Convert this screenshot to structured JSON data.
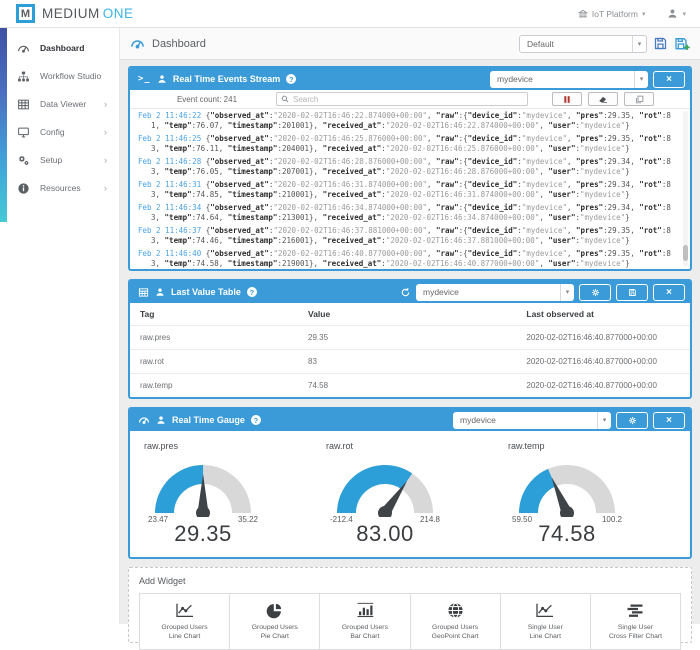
{
  "header": {
    "logo_letter": "M",
    "brand_primary": "MEDIUM",
    "brand_secondary": "ONE",
    "platform_menu": "IoT Platform"
  },
  "glyphs": {
    "caret_down": "▾",
    "chevron_right": "›",
    "close": "×",
    "terminal_prompt": ">_"
  },
  "sidebar": {
    "items": [
      {
        "label": "Dashboard",
        "icon": "gauge-icon",
        "active": true,
        "has_chevron": false
      },
      {
        "label": "Workflow Studio",
        "icon": "sitemap-icon",
        "active": false,
        "has_chevron": false
      },
      {
        "label": "Data Viewer",
        "icon": "table-icon",
        "active": false,
        "has_chevron": true
      },
      {
        "label": "Config",
        "icon": "desktop-icon",
        "active": false,
        "has_chevron": true
      },
      {
        "label": "Setup",
        "icon": "gears-icon",
        "active": false,
        "has_chevron": true
      },
      {
        "label": "Resources",
        "icon": "info-icon",
        "active": false,
        "has_chevron": true
      }
    ]
  },
  "topbar": {
    "title": "Dashboard",
    "dashboard_select_value": "Default"
  },
  "events_stream": {
    "title": "Real Time Events Stream",
    "device_select_value": "mydevice",
    "event_count_label": "Event count: 241",
    "search_placeholder": "Search",
    "entries": [
      {
        "time": "Feb 2 11:46:22",
        "json": "{\"observed_at\":\"2020-02-02T16:46:22.874000+00:00\", \"raw\":{\"device_id\":\"mydevice\", \"pres\":29.35, \"rot\":81, \"temp\":76.07, \"timestamp\":201001}, \"received_at\":\"2020-02-02T16:46:22.874000+00:00\", \"user\":\"mydevice\"}"
      },
      {
        "time": "Feb 2 11:46:25",
        "json": "{\"observed_at\":\"2020-02-02T16:46:25.876000+00:00\", \"raw\":{\"device_id\":\"mydevice\", \"pres\":29.35, \"rot\":83, \"temp\":76.11, \"timestamp\":204001}, \"received_at\":\"2020-02-02T16:46:25.876000+00:00\", \"user\":\"mydevice\"}"
      },
      {
        "time": "Feb 2 11:46:28",
        "json": "{\"observed_at\":\"2020-02-02T16:46:28.876000+00:00\", \"raw\":{\"device_id\":\"mydevice\", \"pres\":29.34, \"rot\":83, \"temp\":76.05, \"timestamp\":207001}, \"received_at\":\"2020-02-02T16:46:28.876000+00:00\", \"user\":\"mydevice\"}"
      },
      {
        "time": "Feb 2 11:46:31",
        "json": "{\"observed_at\":\"2020-02-02T16:46:31.874000+00:00\", \"raw\":{\"device_id\":\"mydevice\", \"pres\":29.34, \"rot\":83, \"temp\":74.85, \"timestamp\":210001}, \"received_at\":\"2020-02-02T16:46:31.874000+00:00\", \"user\":\"mydevice\"}"
      },
      {
        "time": "Feb 2 11:46:34",
        "json": "{\"observed_at\":\"2020-02-02T16:46:34.874000+00:00\", \"raw\":{\"device_id\":\"mydevice\", \"pres\":29.34, \"rot\":83, \"temp\":74.64, \"timestamp\":213001}, \"received_at\":\"2020-02-02T16:46:34.874000+00:00\", \"user\":\"mydevice\"}"
      },
      {
        "time": "Feb 2 11:46:37",
        "json": "{\"observed_at\":\"2020-02-02T16:46:37.881000+00:00\", \"raw\":{\"device_id\":\"mydevice\", \"pres\":29.35, \"rot\":83, \"temp\":74.46, \"timestamp\":216001}, \"received_at\":\"2020-02-02T16:46:37.881000+00:00\", \"user\":\"mydevice\"}"
      },
      {
        "time": "Feb 2 11:46:40",
        "json": "{\"observed_at\":\"2020-02-02T16:46:40.877000+00:00\", \"raw\":{\"device_id\":\"mydevice\", \"pres\":29.35, \"rot\":83, \"temp\":74.58, \"timestamp\":219001}, \"received_at\":\"2020-02-02T16:46:40.877000+00:00\", \"user\":\"mydevice\"}"
      }
    ]
  },
  "last_value_table": {
    "title": "Last Value Table",
    "device_select_value": "mydevice",
    "columns": [
      "Tag",
      "Value",
      "Last observed at"
    ],
    "rows": [
      [
        "raw.pres",
        "29.35",
        "2020-02-02T16:46:40.877000+00:00"
      ],
      [
        "raw.rot",
        "83",
        "2020-02-02T16:46:40.877000+00:00"
      ],
      [
        "raw.temp",
        "74.58",
        "2020-02-02T16:46:40.877000+00:00"
      ]
    ]
  },
  "gauge_panel": {
    "title": "Real Time Gauge",
    "device_select_value": "mydevice",
    "gauges": [
      {
        "label": "raw.pres",
        "min": 23.47,
        "max": 35.22,
        "value": 29.35,
        "min_label": "23.47",
        "max_label": "35.22",
        "value_label": "29.35"
      },
      {
        "label": "raw.rot",
        "min": -212.4,
        "max": 214.8,
        "value": 83,
        "min_label": "-212.4",
        "max_label": "214.8",
        "value_label": "83.00"
      },
      {
        "label": "raw.temp",
        "min": 59.5,
        "max": 100.2,
        "value": 74.58,
        "min_label": "59.50",
        "max_label": "100.2",
        "value_label": "74.58"
      }
    ]
  },
  "add_widget": {
    "title": "Add Widget",
    "tiles": [
      {
        "line1": "Grouped Users",
        "line2": "Line Chart",
        "icon": "line-chart-icon"
      },
      {
        "line1": "Grouped Users",
        "line2": "Pie Chart",
        "icon": "pie-chart-icon"
      },
      {
        "line1": "Grouped Users",
        "line2": "Bar Chart",
        "icon": "bar-chart-icon"
      },
      {
        "line1": "Grouped Users",
        "line2": "GeoPoint Chart",
        "icon": "globe-icon"
      },
      {
        "line1": "Single User",
        "line2": "Line Chart",
        "icon": "line-chart-icon"
      },
      {
        "line1": "Single User",
        "line2": "Cross Filter Chart",
        "icon": "cross-filter-icon"
      }
    ]
  },
  "colors": {
    "panel_header_blue": "#3a9bd8",
    "gauge_blue": "#2d9fd8",
    "gauge_track_gray": "#d8d8d8",
    "needle_dark": "#3f4449",
    "pause_red": "#b5352c",
    "log_time_blue": "#4aa3e8",
    "brand_blue": "#3db5e6",
    "save_plus_green": "#3aa655"
  }
}
